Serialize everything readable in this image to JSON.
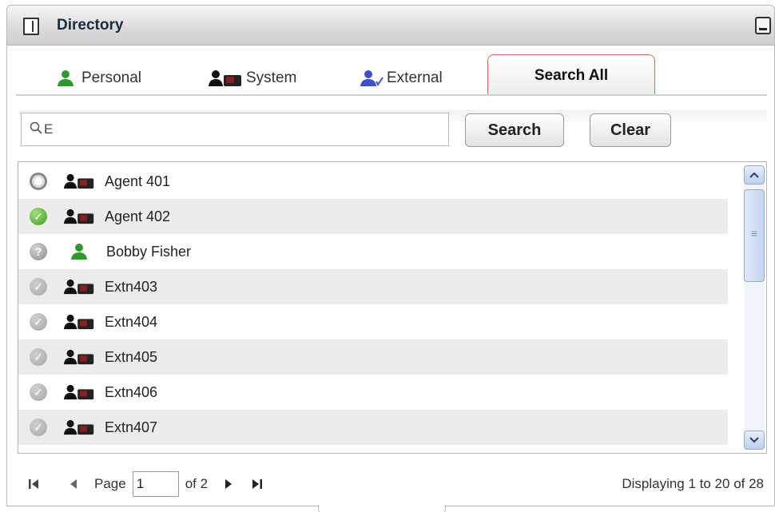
{
  "window": {
    "title": "Directory"
  },
  "tabs": [
    {
      "label": "Personal",
      "icon": "person-green-icon",
      "active": false
    },
    {
      "label": "System",
      "icon": "person-phone-icon",
      "active": false
    },
    {
      "label": "External",
      "icon": "person-blue-arrow-icon",
      "active": false
    },
    {
      "label": "Search All",
      "active": true
    }
  ],
  "search": {
    "value": "E",
    "search_label": "Search",
    "clear_label": "Clear"
  },
  "contacts": [
    {
      "name": "Agent 401",
      "status": "offline",
      "type": "system"
    },
    {
      "name": "Agent 402",
      "status": "available",
      "type": "system"
    },
    {
      "name": "Bobby Fisher",
      "status": "unknown",
      "type": "personal"
    },
    {
      "name": "Extn403",
      "status": "idle",
      "type": "system"
    },
    {
      "name": "Extn404",
      "status": "idle",
      "type": "system"
    },
    {
      "name": "Extn405",
      "status": "idle",
      "type": "system"
    },
    {
      "name": "Extn406",
      "status": "idle",
      "type": "system"
    },
    {
      "name": "Extn407",
      "status": "idle",
      "type": "system"
    }
  ],
  "pager": {
    "page_label": "Page",
    "page_value": "1",
    "of_label": "of 2",
    "displaying": "Displaying 1 to 20 of 28"
  },
  "colors": {
    "accent_tab_border": "#d76b55",
    "personal_green": "#2e9a2e",
    "external_blue": "#3d4fc8",
    "scroll_blue": "#bcd0ef"
  }
}
